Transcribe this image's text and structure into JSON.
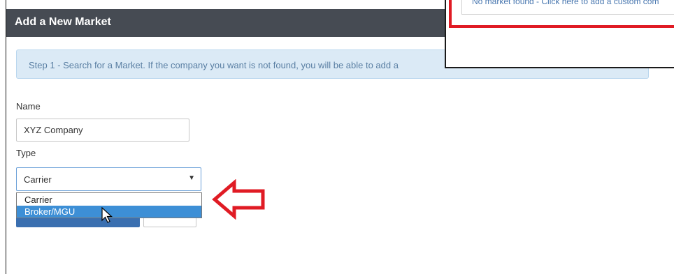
{
  "header": {
    "title": "Add a New Market"
  },
  "step": {
    "text": "Step 1 - Search for a Market. If the company you want is not found, you will be able to add a"
  },
  "form": {
    "name_label": "Name",
    "name_value": "XYZ Company",
    "type_label": "Type",
    "type_value": "Carrier",
    "type_options": [
      "Carrier",
      "Broker/MGU"
    ],
    "highlighted_option": "Broker/MGU"
  },
  "popup": {
    "link_text": "No market found - Click here to add a custom com"
  },
  "colors": {
    "header_bg": "#464b53",
    "banner_bg": "#dbeaf6",
    "accent_red": "#e01b24",
    "highlight_blue": "#3d8fd6",
    "primary_button": "#3a6fb0"
  },
  "icons": {
    "select_caret": "▼",
    "annotation": "red-arrow-left-icon",
    "cursor": "mouse-pointer-icon"
  }
}
